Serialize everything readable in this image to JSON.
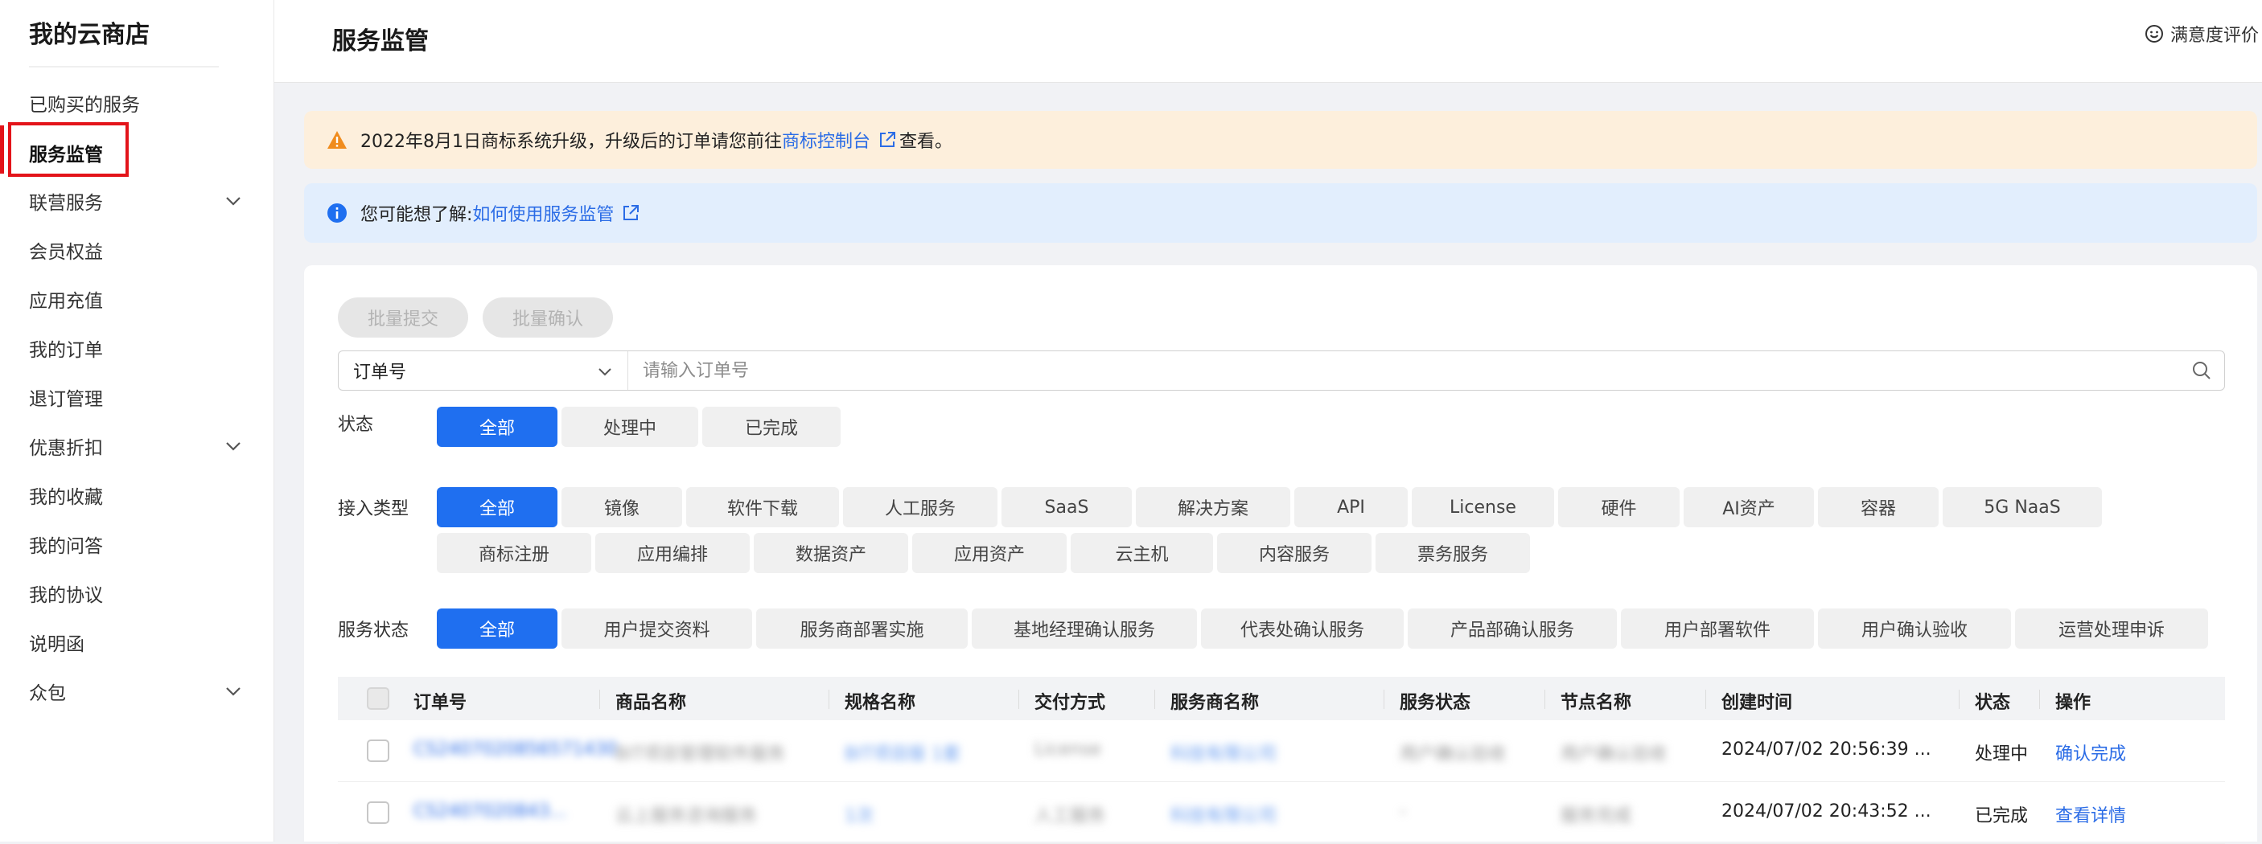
{
  "sidebar": {
    "title": "我的云商店",
    "items": [
      {
        "label": "已购买的服务",
        "has_chevron": false
      },
      {
        "label": "服务监管",
        "has_chevron": false,
        "active": true
      },
      {
        "label": "联营服务",
        "has_chevron": true
      },
      {
        "label": "会员权益",
        "has_chevron": false
      },
      {
        "label": "应用充值",
        "has_chevron": false
      },
      {
        "label": "我的订单",
        "has_chevron": false
      },
      {
        "label": "退订管理",
        "has_chevron": false
      },
      {
        "label": "优惠折扣",
        "has_chevron": true
      },
      {
        "label": "我的收藏",
        "has_chevron": false
      },
      {
        "label": "我的问答",
        "has_chevron": false
      },
      {
        "label": "我的协议",
        "has_chevron": false
      },
      {
        "label": "说明函",
        "has_chevron": false
      },
      {
        "label": "众包",
        "has_chevron": true
      }
    ]
  },
  "header": {
    "title": "服务监管",
    "satisfaction_label": "满意度评价"
  },
  "alerts": {
    "warning": {
      "text_before": "2022年8月1日商标系统升级，升级后的订单请您前往",
      "link": "商标控制台",
      "text_after": "查看。"
    },
    "info": {
      "text_before": "您可能想了解: ",
      "link": "如何使用服务监管"
    }
  },
  "toolbar": {
    "batch_submit": "批量提交",
    "batch_confirm": "批量确认"
  },
  "search": {
    "field": "订单号",
    "placeholder": "请输入订单号"
  },
  "filters": {
    "status": {
      "label": "状态",
      "options": [
        "全部",
        "处理中",
        "已完成"
      ],
      "selected": "全部"
    },
    "access_type": {
      "label": "接入类型",
      "options": [
        "全部",
        "镜像",
        "软件下载",
        "人工服务",
        "SaaS",
        "解决方案",
        "API",
        "License",
        "硬件",
        "AI资产",
        "容器",
        "5G NaaS",
        "商标注册",
        "应用编排",
        "数据资产",
        "应用资产",
        "云主机",
        "内容服务",
        "票务服务"
      ],
      "selected": "全部"
    },
    "service_status": {
      "label": "服务状态",
      "options": [
        "全部",
        "用户提交资料",
        "服务商部署实施",
        "基地经理确认服务",
        "代表处确认服务",
        "产品部确认服务",
        "用户部署软件",
        "用户确认验收",
        "运营处理申诉"
      ],
      "selected": "全部"
    }
  },
  "table": {
    "columns": [
      "订单号",
      "商品名称",
      "规格名称",
      "交付方式",
      "服务商名称",
      "服务状态",
      "节点名称",
      "创建时间",
      "状态",
      "操作"
    ],
    "rows": [
      {
        "order_id": "CS2407020856571430",
        "product": "BIT项目管理软件服务",
        "spec": "BIT项目版 1套",
        "delivery": "License",
        "vendor": "科技有限公司",
        "service_status": "用户确认验收",
        "node": "用户确认验收",
        "created": "2024/07/02 20:56:39 ...",
        "status": "处理中",
        "action": "确认完成"
      },
      {
        "order_id": "CS2407020843...",
        "product": "云上服务咨询服务",
        "spec": "1次",
        "delivery": "人工服务",
        "vendor": "科技有限公司",
        "service_status": "-",
        "node": "服务完成",
        "created": "2024/07/02 20:43:52 ...",
        "status": "已完成",
        "action": "查看详情"
      }
    ]
  },
  "colors": {
    "primary": "#1f6ff0",
    "link": "#2b6ce6",
    "highlight_box": "#e3141a",
    "warning_bg": "#fdefdc",
    "warning_icon": "#f08c1e",
    "info_bg": "#e2eefd",
    "info_icon": "#1f6ff0"
  }
}
